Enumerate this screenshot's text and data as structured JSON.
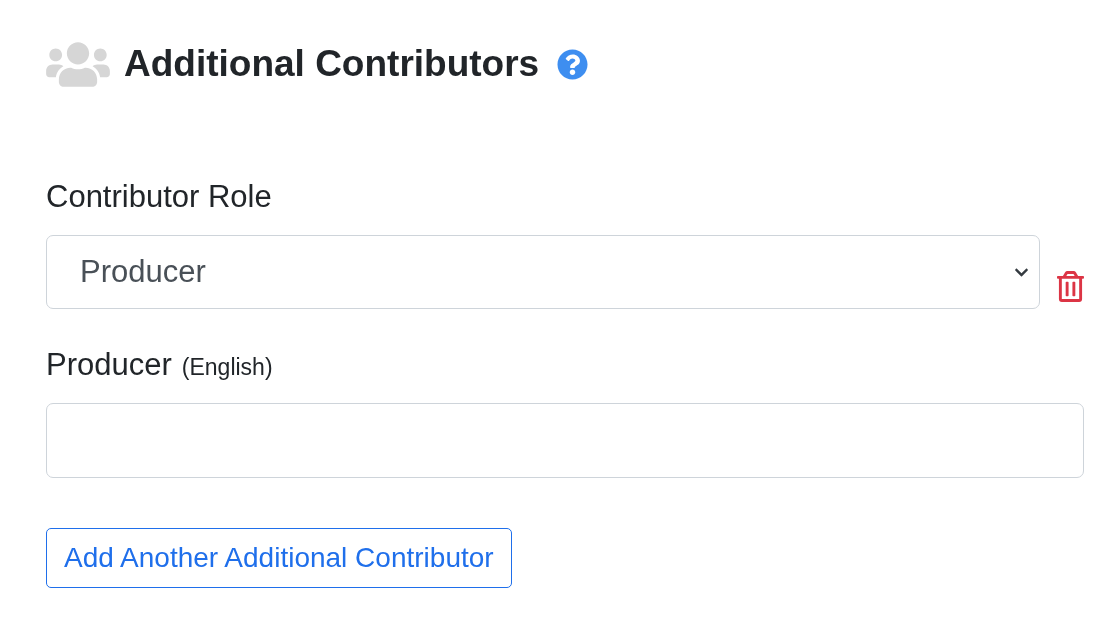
{
  "section": {
    "title": "Additional Contributors"
  },
  "contributors": [
    {
      "role": {
        "label": "Contributor Role",
        "value": "Producer"
      },
      "name": {
        "label": "Producer",
        "language": "(English)"
      }
    }
  ],
  "add_button": "Add Another Additional Contributor"
}
